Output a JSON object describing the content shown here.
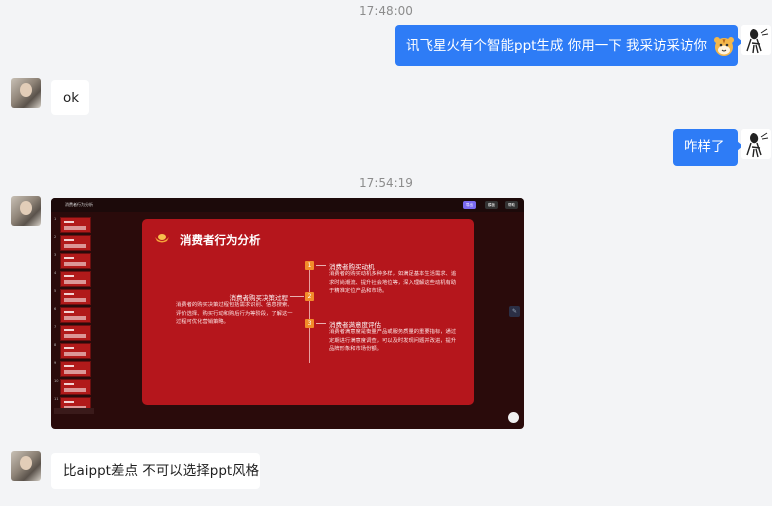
{
  "messages": {
    "ts1": "17:48:00",
    "m1": "讯飞星火有个智能ppt生成 你用一下 我采访采访你",
    "m2": "ok",
    "m3": "咋样了",
    "ts2": "17:54:19",
    "m4": "比aippt差点 不可以选择ppt风格"
  },
  "screenshot": {
    "app_title": "消费者行为分析",
    "toolbar": [
      "导出",
      "模板",
      "帮助"
    ],
    "thumb_numbers": [
      "1",
      "2",
      "3",
      "4",
      "5",
      "6",
      "7",
      "8",
      "9",
      "10",
      "11"
    ],
    "slide": {
      "title": "消费者行为分析",
      "left_heading": "消费者购买决策过程",
      "left_text": "消费者的购买决策过程包括需求识别、信息搜索、评价选择、购买行动和购后行为等阶段，了解这一过程可优化营销策略。",
      "items": [
        {
          "num": "1",
          "heading": "消费者购买动机",
          "text": "消费者的购买动机多种多样，如满足基本生活需求、追求时尚潮流、提升社会地位等，深入理解这些动机有助于精准定位产品和市场。"
        },
        {
          "num": "2"
        },
        {
          "num": "3",
          "heading": "消费者满意度评估",
          "text": "消费者满意度是衡量产品或服务质量的重要指标，通过定期进行满意度调查，可以及时发现问题并改进，提升品牌形象和市场份额。"
        }
      ]
    }
  },
  "colors": {
    "bubble_out": "#2e7cf6",
    "slide_bg": "#b5161c",
    "accent": "#f28c2a"
  }
}
